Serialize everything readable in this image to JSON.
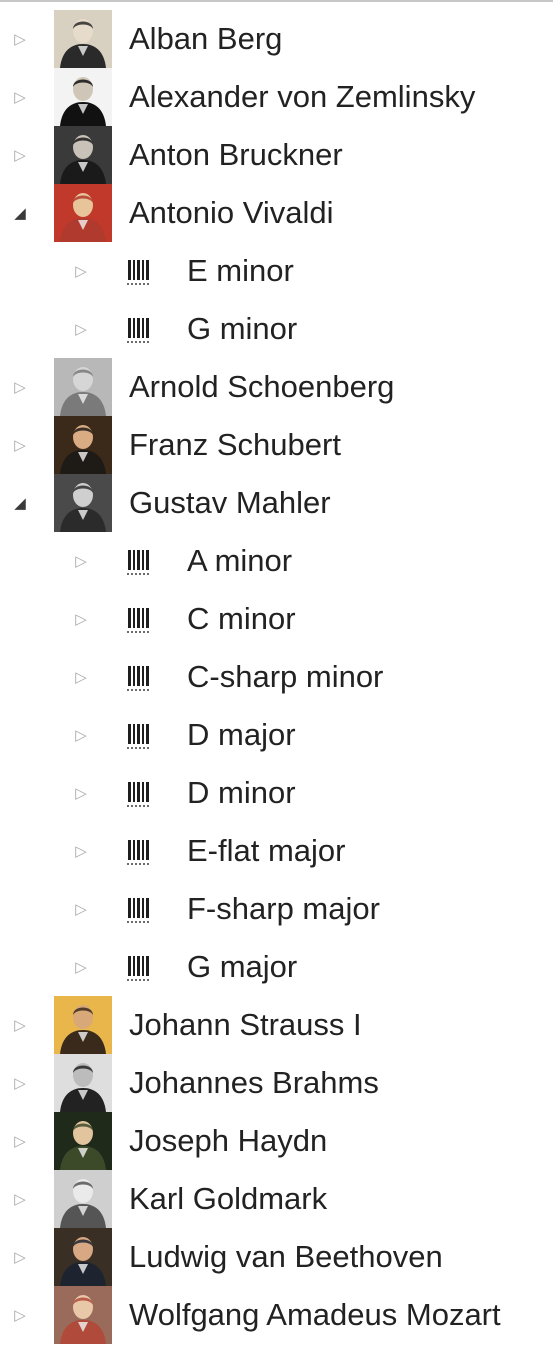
{
  "tree": {
    "rows": [
      {
        "type": "composer",
        "label": "Alban Berg",
        "expanded": false,
        "portrait": {
          "bg": "#d8d0c0",
          "coat": "#2a2a2a",
          "face": "#e7dccb"
        }
      },
      {
        "type": "composer",
        "label": "Alexander von Zemlinsky",
        "expanded": false,
        "portrait": {
          "bg": "#f3f3f3",
          "coat": "#111111",
          "face": "#cfc6b8"
        }
      },
      {
        "type": "composer",
        "label": "Anton Bruckner",
        "expanded": false,
        "portrait": {
          "bg": "#3a3a3a",
          "coat": "#1a1a1a",
          "face": "#c9c2b8"
        }
      },
      {
        "type": "composer",
        "label": "Antonio Vivaldi",
        "expanded": true,
        "portrait": {
          "bg": "#c0392b",
          "coat": "#b03a2e",
          "face": "#e8c49a"
        }
      },
      {
        "type": "key",
        "label": "E minor",
        "expanded": false
      },
      {
        "type": "key",
        "label": "G minor",
        "expanded": false
      },
      {
        "type": "composer",
        "label": "Arnold Schoenberg",
        "expanded": false,
        "portrait": {
          "bg": "#b8b8b8",
          "coat": "#7a7a7a",
          "face": "#d6d6d6"
        }
      },
      {
        "type": "composer",
        "label": "Franz Schubert",
        "expanded": false,
        "portrait": {
          "bg": "#3b2a1a",
          "coat": "#1e1a16",
          "face": "#d9ac84"
        }
      },
      {
        "type": "composer",
        "label": "Gustav Mahler",
        "expanded": true,
        "portrait": {
          "bg": "#4a4a4a",
          "coat": "#2b2b2b",
          "face": "#cfcfcf"
        }
      },
      {
        "type": "key",
        "label": "A minor",
        "expanded": false
      },
      {
        "type": "key",
        "label": "C minor",
        "expanded": false
      },
      {
        "type": "key",
        "label": "C-sharp minor",
        "expanded": false
      },
      {
        "type": "key",
        "label": "D major",
        "expanded": false
      },
      {
        "type": "key",
        "label": "D minor",
        "expanded": false
      },
      {
        "type": "key",
        "label": "E-flat major",
        "expanded": false
      },
      {
        "type": "key",
        "label": "F-sharp major",
        "expanded": false
      },
      {
        "type": "key",
        "label": "G major",
        "expanded": false
      },
      {
        "type": "composer",
        "label": "Johann Strauss I",
        "expanded": false,
        "portrait": {
          "bg": "#e8b64a",
          "coat": "#3a2a1c",
          "face": "#d9a879"
        }
      },
      {
        "type": "composer",
        "label": "Johannes Brahms",
        "expanded": false,
        "portrait": {
          "bg": "#dedede",
          "coat": "#222222",
          "face": "#bcbcbc"
        }
      },
      {
        "type": "composer",
        "label": "Joseph Haydn",
        "expanded": false,
        "portrait": {
          "bg": "#1f2a1a",
          "coat": "#3d4a2a",
          "face": "#e2c49e"
        }
      },
      {
        "type": "composer",
        "label": "Karl Goldmark",
        "expanded": false,
        "portrait": {
          "bg": "#cfcfcf",
          "coat": "#555555",
          "face": "#eaeaea"
        }
      },
      {
        "type": "composer",
        "label": "Ludwig van Beethoven",
        "expanded": false,
        "portrait": {
          "bg": "#3a2f24",
          "coat": "#1d2430",
          "face": "#d8a784"
        }
      },
      {
        "type": "composer",
        "label": "Wolfgang Amadeus Mozart",
        "expanded": false,
        "portrait": {
          "bg": "#9a6a5a",
          "coat": "#b04a3a",
          "face": "#e9c8a8"
        }
      }
    ],
    "icons": {
      "collapsed": "▷",
      "expanded": "◢",
      "key_node": "score-icon",
      "composer_node": "portrait"
    }
  }
}
